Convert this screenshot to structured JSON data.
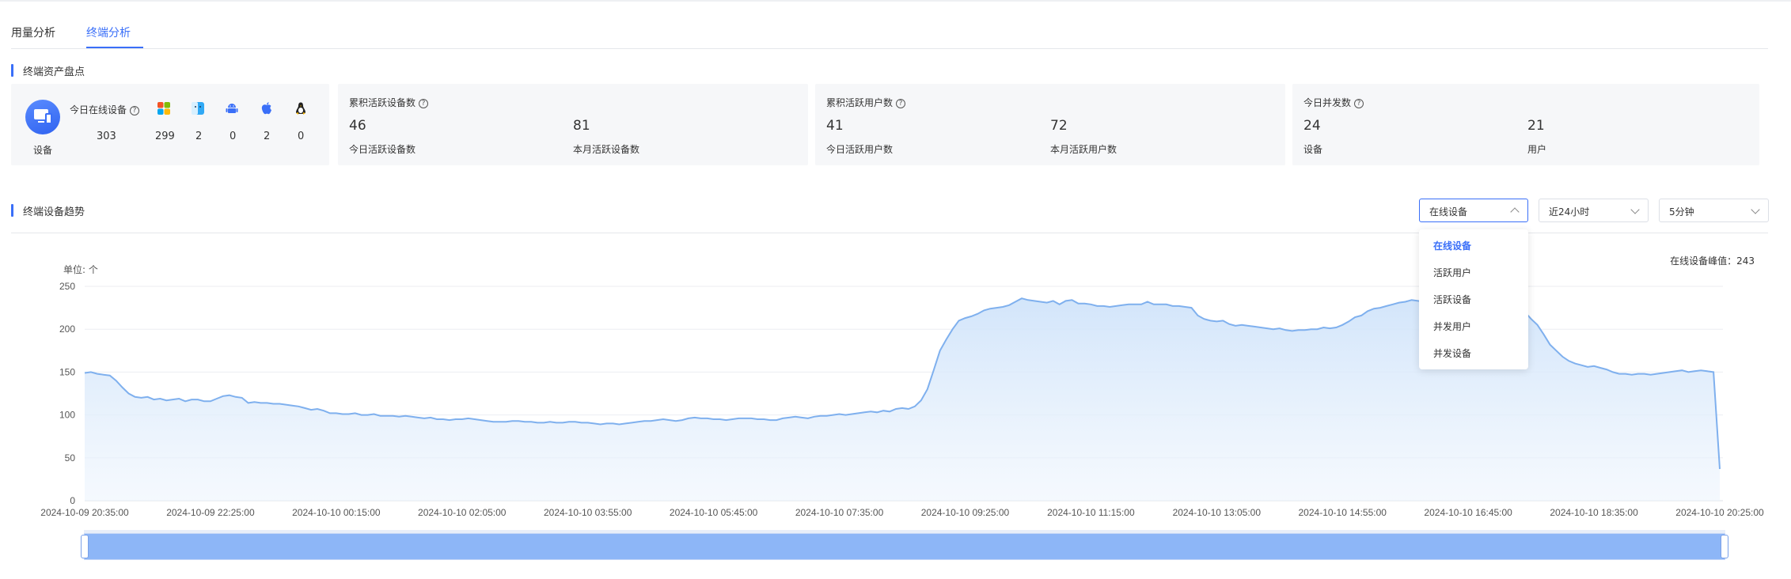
{
  "tabs": [
    {
      "label": "用量分析",
      "active": false
    },
    {
      "label": "终端分析",
      "active": true
    }
  ],
  "asset_section": {
    "title": "终端资产盘点"
  },
  "online_card": {
    "icon_label": "设备",
    "title": "今日在线设备",
    "help": "?",
    "total": "303",
    "platforms": [
      {
        "icon": "windows-icon",
        "value": "299"
      },
      {
        "icon": "mac-finder-icon",
        "value": "2"
      },
      {
        "icon": "android-icon",
        "value": "0"
      },
      {
        "icon": "apple-icon",
        "value": "2"
      },
      {
        "icon": "linux-icon",
        "value": "0"
      }
    ]
  },
  "stat_cards": [
    {
      "title": "累积活跃设备数",
      "left_value": "46",
      "left_label": "今日活跃设备数",
      "right_value": "81",
      "right_label": "本月活跃设备数"
    },
    {
      "title": "累积活跃用户数",
      "left_value": "41",
      "left_label": "今日活跃用户数",
      "right_value": "72",
      "right_label": "本月活跃用户数"
    },
    {
      "title": "今日并发数",
      "left_value": "24",
      "left_label": "设备",
      "right_value": "21",
      "right_label": "用户"
    }
  ],
  "trend_section": {
    "title": "终端设备趋势"
  },
  "filters": {
    "metric": "在线设备",
    "range": "近24小时",
    "interval": "5分钟"
  },
  "dropdown_options": [
    "在线设备",
    "活跃用户",
    "活跃设备",
    "并发用户",
    "并发设备"
  ],
  "chart_meta": {
    "peak_label": "在线设备峰值：243",
    "unit": "单位: 个"
  },
  "colors": {
    "accent": "#3a6ff8",
    "line": "#7fb0ee",
    "area_top": "#d9e9fb",
    "slider": "#8db6f7"
  },
  "chart_data": {
    "type": "area",
    "ylabel": "单位: 个",
    "ylim": [
      0,
      250
    ],
    "yticks": [
      0,
      50,
      100,
      150,
      200,
      250
    ],
    "xticks": [
      "2024-10-09 20:35:00",
      "2024-10-09 22:25:00",
      "2024-10-10 00:15:00",
      "2024-10-10 02:05:00",
      "2024-10-10 03:55:00",
      "2024-10-10 05:45:00",
      "2024-10-10 07:35:00",
      "2024-10-10 09:25:00",
      "2024-10-10 11:15:00",
      "2024-10-10 13:05:00",
      "2024-10-10 14:55:00",
      "2024-10-10 16:45:00",
      "2024-10-10 18:35:00",
      "2024-10-10 20:25:00"
    ],
    "series": [
      {
        "name": "在线设备",
        "values": [
          149,
          150,
          148,
          147,
          146,
          140,
          132,
          125,
          121,
          120,
          121,
          118,
          119,
          117,
          118,
          119,
          116,
          118,
          118,
          116,
          116,
          119,
          122,
          123,
          121,
          120,
          114,
          115,
          114,
          114,
          113,
          113,
          112,
          111,
          110,
          108,
          106,
          107,
          105,
          102,
          102,
          101,
          101,
          102,
          100,
          100,
          101,
          99,
          99,
          99,
          98,
          99,
          98,
          97,
          96,
          97,
          95,
          95,
          94,
          95,
          95,
          96,
          95,
          94,
          93,
          92,
          92,
          92,
          93,
          93,
          92,
          92,
          91,
          91,
          92,
          91,
          91,
          92,
          92,
          91,
          91,
          90,
          89,
          90,
          90,
          89,
          90,
          91,
          92,
          93,
          93,
          94,
          95,
          94,
          93,
          94,
          96,
          97,
          96,
          96,
          95,
          95,
          94,
          95,
          96,
          96,
          96,
          95,
          95,
          94,
          94,
          96,
          97,
          98,
          97,
          96,
          98,
          99,
          99,
          100,
          101,
          100,
          101,
          102,
          103,
          104,
          103,
          105,
          104,
          107,
          108,
          107,
          110,
          117,
          130,
          152,
          175,
          188,
          200,
          210,
          213,
          215,
          218,
          222,
          224,
          225,
          226,
          228,
          232,
          236,
          234,
          233,
          232,
          231,
          233,
          229,
          233,
          234,
          230,
          230,
          229,
          227,
          227,
          226,
          227,
          228,
          229,
          229,
          229,
          232,
          229,
          229,
          229,
          227,
          227,
          226,
          225,
          216,
          212,
          210,
          209,
          210,
          206,
          204,
          205,
          204,
          203,
          202,
          201,
          200,
          201,
          199,
          198,
          199,
          199,
          200,
          200,
          202,
          201,
          202,
          205,
          209,
          214,
          216,
          221,
          224,
          225,
          227,
          229,
          231,
          232,
          234,
          233,
          232,
          234,
          235,
          236,
          236,
          236,
          237,
          238,
          240,
          241,
          239,
          240,
          238,
          235,
          230,
          225,
          220,
          212,
          205,
          194,
          182,
          175,
          168,
          163,
          160,
          158,
          156,
          157,
          155,
          153,
          150,
          148,
          148,
          147,
          148,
          148,
          147,
          148,
          149,
          150,
          151,
          152,
          150,
          151,
          152,
          151,
          150,
          37
        ]
      }
    ]
  }
}
